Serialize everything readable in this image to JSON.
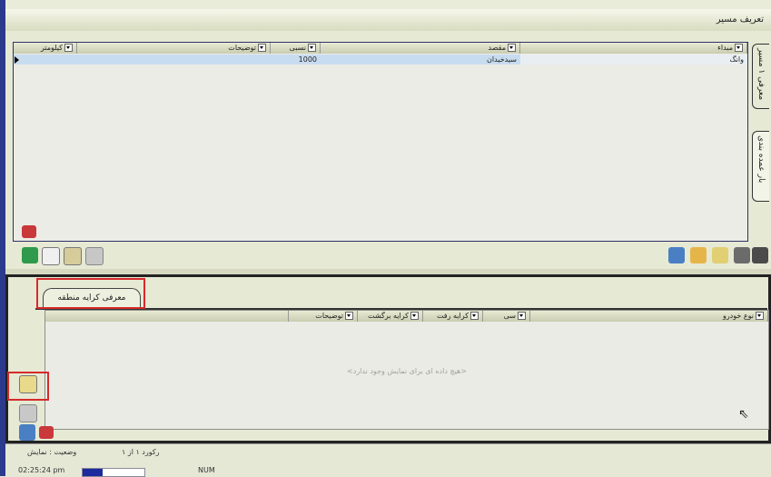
{
  "window": {
    "title": "تعریف مسیر"
  },
  "top_grid": {
    "headers": {
      "origin": "مبداء",
      "destination": "مقصد",
      "percent": "نسبی",
      "notes": "توضیحات",
      "km": "کیلومتر"
    },
    "rows": [
      {
        "origin": "وانگ",
        "destination": "سیدخیدان",
        "percent": "1000",
        "notes": "",
        "km": ""
      }
    ]
  },
  "side_tabs": {
    "tab1": "معرفی ۱ مسیر",
    "tab2": "بار عمده بندی"
  },
  "bottom": {
    "tab_label": "معرفی کرایه منطقه",
    "headers": {
      "vehicle": "نوع خودرو",
      "col2": "سی",
      "fare_go": "کرایه رفت",
      "fare_return": "کرایه برگشت",
      "notes": "توضیحات"
    },
    "empty_message": "<هیچ داده ای برای نمایش وجود ندارد>"
  },
  "statusbar": {
    "record": "رکورد ۱ از ۱",
    "state": "وضعیت : نمایش",
    "time": "02:25:24 pm",
    "progress_percent": 33,
    "progress_label": "33%",
    "num": "NUM"
  }
}
